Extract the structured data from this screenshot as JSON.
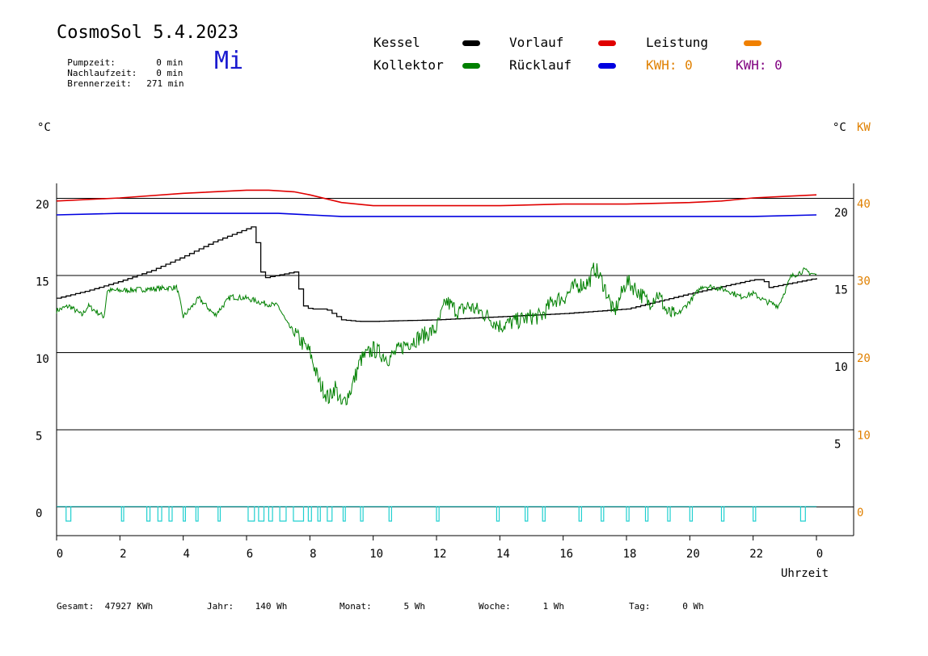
{
  "header": {
    "title": "CosmoSol 5.4.2023",
    "weekday": "Mi",
    "info": [
      {
        "label": "Pumpzeit:",
        "value": "0 min"
      },
      {
        "label": "Nachlaufzeit:",
        "value": "0 min"
      },
      {
        "label": "Brennerzeit:",
        "value": "271 min"
      }
    ]
  },
  "legend": [
    {
      "label": "Kessel",
      "color": "#000000"
    },
    {
      "label": "Vorlauf",
      "color": "#e00000"
    },
    {
      "label": "Leistung",
      "color": "#f08000"
    },
    {
      "label": "Kollektor",
      "color": "#008000"
    },
    {
      "label": "Rücklauf",
      "color": "#0000e0"
    }
  ],
  "kwh": [
    {
      "text": "KWH: 0",
      "color": "#e08000"
    },
    {
      "text": "KWH: 0",
      "color": "#800080"
    }
  ],
  "axes": {
    "left_unit": "°C",
    "right_unit_c": "°C",
    "right_unit_kw": "KW",
    "xlabel": "Uhrzeit"
  },
  "footer": [
    {
      "label": "Gesamt:",
      "value": "47927 KWh"
    },
    {
      "label": "Jahr:",
      "value": "140 Wh"
    },
    {
      "label": "Monat:",
      "value": "5 Wh"
    },
    {
      "label": "Woche:",
      "value": "1 Wh"
    },
    {
      "label": "Tag:",
      "value": "0 Wh"
    }
  ],
  "chart_data": {
    "type": "line",
    "xlim": [
      0,
      24
    ],
    "x_ticks": [
      "0",
      "2",
      "4",
      "6",
      "8",
      "10",
      "12",
      "14",
      "16",
      "18",
      "20",
      "22",
      "0"
    ],
    "left_ylim": [
      0,
      21.5
    ],
    "left_ticks": [
      "0",
      "5",
      "10",
      "15",
      "20"
    ],
    "right_c_ticks": [
      "5",
      "10",
      "15",
      "20"
    ],
    "right_kw_ticks": [
      "0",
      "10",
      "20",
      "30",
      "40"
    ],
    "gridlines_c": [
      0,
      5,
      10,
      15,
      20
    ],
    "series": [
      {
        "name": "Vorlauf",
        "color": "#e00000",
        "x": [
          0,
          2,
          4,
          6,
          6.7,
          7.5,
          8,
          9,
          10,
          12,
          14,
          16,
          18,
          20,
          21,
          22,
          23,
          24
        ],
        "y": [
          19.8,
          20.0,
          20.3,
          20.5,
          20.5,
          20.4,
          20.2,
          19.7,
          19.5,
          19.5,
          19.5,
          19.6,
          19.6,
          19.7,
          19.8,
          20.0,
          20.1,
          20.2
        ]
      },
      {
        "name": "Rücklauf",
        "color": "#0000e0",
        "x": [
          0,
          2,
          4,
          6,
          7,
          8,
          9,
          10,
          12,
          14,
          16,
          18,
          20,
          22,
          24
        ],
        "y": [
          18.9,
          19.0,
          19.0,
          19.0,
          19.0,
          18.9,
          18.8,
          18.8,
          18.8,
          18.8,
          18.8,
          18.8,
          18.8,
          18.8,
          18.9
        ]
      },
      {
        "name": "Kessel",
        "color": "#000000",
        "x": [
          0,
          1,
          2,
          3,
          4,
          5,
          6,
          6.25,
          6.35,
          6.5,
          7,
          7.5,
          7.8,
          8,
          8.5,
          9,
          9.5,
          10,
          12,
          14,
          16,
          18,
          20,
          22,
          22.3,
          22.5,
          23,
          24
        ],
        "y": [
          13.5,
          14.0,
          14.6,
          15.3,
          16.2,
          17.2,
          18.0,
          18.2,
          16.0,
          14.8,
          15.0,
          15.2,
          13.0,
          12.8,
          12.8,
          12.1,
          12.0,
          12.0,
          12.1,
          12.3,
          12.5,
          12.8,
          13.8,
          14.7,
          14.7,
          14.2,
          14.4,
          14.8
        ],
        "step": true
      },
      {
        "name": "Kollektor",
        "color": "#008000",
        "x": [
          0,
          0.4,
          0.8,
          1,
          1.5,
          1.6,
          2,
          3,
          3.8,
          4,
          4.5,
          5,
          5.5,
          6,
          6.5,
          7,
          7.3,
          7.6,
          8,
          8.3,
          8.6,
          8.8,
          9,
          9.3,
          9.6,
          10,
          10.5,
          11,
          11.5,
          12,
          12.3,
          12.7,
          13,
          13.5,
          14,
          14.5,
          15,
          15.3,
          15.7,
          16,
          16.4,
          16.8,
          17,
          17.3,
          17.6,
          18,
          18.3,
          18.7,
          19,
          19.3,
          19.6,
          20,
          20.4,
          20.8,
          21.2,
          21.6,
          22,
          22.4,
          22.8,
          23.2,
          23.6,
          24
        ],
        "y": [
          12.7,
          13.0,
          12.4,
          13.0,
          12.3,
          14.0,
          14.0,
          14.1,
          14.2,
          12.3,
          13.5,
          12.4,
          13.6,
          13.5,
          13.2,
          13.0,
          11.8,
          11.0,
          10.0,
          8.0,
          7.0,
          7.8,
          6.5,
          7.6,
          9.5,
          10.2,
          9.6,
          10.5,
          11.0,
          11.5,
          13.3,
          12.6,
          13.0,
          12.5,
          11.7,
          12.0,
          12.3,
          12.3,
          13.4,
          13.5,
          14.3,
          14.5,
          15.5,
          14.3,
          12.5,
          14.6,
          14.1,
          13.2,
          13.8,
          12.5,
          12.4,
          13.3,
          14.3,
          14.2,
          14.0,
          13.6,
          13.8,
          13.3,
          13.0,
          14.9,
          15.3,
          15.0
        ],
        "noisy": true
      },
      {
        "name": "Pumpe",
        "color": "#20d0d0",
        "pulses": [
          [
            0.3,
            0.45
          ],
          [
            2.05,
            2.12
          ],
          [
            2.85,
            2.95
          ],
          [
            3.2,
            3.32
          ],
          [
            3.55,
            3.65
          ],
          [
            4.0,
            4.07
          ],
          [
            4.4,
            4.47
          ],
          [
            5.1,
            5.17
          ],
          [
            6.05,
            6.25
          ],
          [
            6.38,
            6.55
          ],
          [
            6.7,
            6.82
          ],
          [
            7.05,
            7.25
          ],
          [
            7.48,
            7.8
          ],
          [
            7.95,
            8.05
          ],
          [
            8.25,
            8.33
          ],
          [
            8.55,
            8.7
          ],
          [
            9.05,
            9.12
          ],
          [
            9.6,
            9.68
          ],
          [
            10.5,
            10.58
          ],
          [
            12.0,
            12.08
          ],
          [
            13.9,
            13.98
          ],
          [
            14.8,
            14.88
          ],
          [
            15.35,
            15.43
          ],
          [
            16.5,
            16.58
          ],
          [
            17.2,
            17.28
          ],
          [
            18.0,
            18.08
          ],
          [
            18.6,
            18.68
          ],
          [
            19.3,
            19.38
          ],
          [
            20.0,
            20.08
          ],
          [
            21.0,
            21.08
          ],
          [
            22.0,
            22.08
          ],
          [
            23.5,
            23.65
          ]
        ]
      }
    ]
  }
}
